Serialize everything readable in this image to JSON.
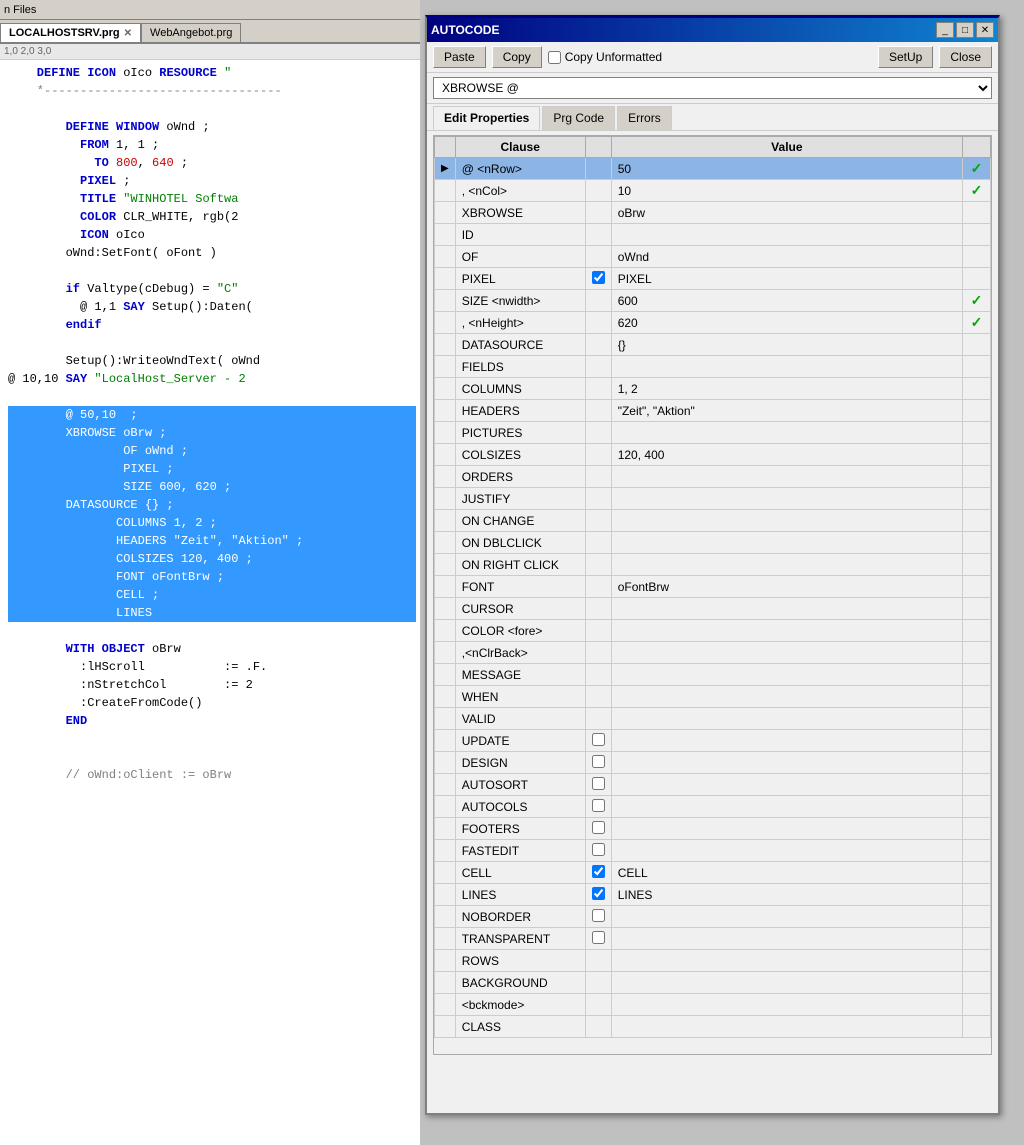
{
  "editor": {
    "toolbar_label": "n Files",
    "tabs": [
      {
        "label": "LOCALHOSTSRV.prg",
        "active": true
      },
      {
        "label": "WebAngebot.prg",
        "active": false
      }
    ],
    "ruler": "          1,0            2,0            3,0",
    "lines": [
      {
        "text": "    DEFINE ICON oIco RESOURCE \"",
        "type": "code",
        "highlight": false
      },
      {
        "text": "    *---------------------------------",
        "type": "comment",
        "highlight": false
      },
      {
        "text": "",
        "type": "blank",
        "highlight": false
      },
      {
        "text": "        DEFINE WINDOW oWnd ;",
        "type": "code",
        "highlight": false
      },
      {
        "text": "          FROM 1, 1 ;",
        "type": "code",
        "highlight": false
      },
      {
        "text": "            TO 800, 640 ;",
        "type": "code",
        "highlight": false
      },
      {
        "text": "          PIXEL ;",
        "type": "code",
        "highlight": false
      },
      {
        "text": "          TITLE \"WINHOTEL Softwa",
        "type": "code",
        "highlight": false
      },
      {
        "text": "          COLOR CLR_WHITE, rgb(2",
        "type": "code",
        "highlight": false
      },
      {
        "text": "          ICON oIco",
        "type": "code",
        "highlight": false
      },
      {
        "text": "        oWnd:SetFont( oFont )",
        "type": "code",
        "highlight": false
      },
      {
        "text": "",
        "type": "blank",
        "highlight": false
      },
      {
        "text": "        if Valtype(cDebug) = \"C\"",
        "type": "code",
        "highlight": false
      },
      {
        "text": "          @ 1,1 SAY Setup():Daten(",
        "type": "code",
        "highlight": false
      },
      {
        "text": "        endif",
        "type": "code",
        "highlight": false
      },
      {
        "text": "",
        "type": "blank",
        "highlight": false
      },
      {
        "text": "        Setup():WriteoWndText( oWnd",
        "type": "code",
        "highlight": false
      },
      {
        "text": "@ 10,10 SAY \"LocalHost_Server - 2",
        "type": "code",
        "highlight": false
      },
      {
        "text": "",
        "type": "blank",
        "highlight": false
      },
      {
        "text": "        @ 50,10  ;",
        "type": "highlight",
        "highlight": true
      },
      {
        "text": "        XBROWSE oBrw ;",
        "type": "highlight",
        "highlight": true
      },
      {
        "text": "                OF oWnd ;",
        "type": "highlight",
        "highlight": true
      },
      {
        "text": "                PIXEL ;",
        "type": "highlight",
        "highlight": true
      },
      {
        "text": "                SIZE 600, 620 ;",
        "type": "highlight",
        "highlight": true
      },
      {
        "text": "        DATASOURCE {} ;",
        "type": "highlight",
        "highlight": true
      },
      {
        "text": "               COLUMNS 1, 2 ;",
        "type": "highlight",
        "highlight": true
      },
      {
        "text": "               HEADERS \"Zeit\", \"Aktion\" ;",
        "type": "highlight",
        "highlight": true
      },
      {
        "text": "               COLSIZES 120, 400 ;",
        "type": "highlight",
        "highlight": true
      },
      {
        "text": "               FONT oFontBrw ;",
        "type": "highlight",
        "highlight": true
      },
      {
        "text": "               CELL ;",
        "type": "highlight",
        "highlight": true
      },
      {
        "text": "               LINES",
        "type": "highlight",
        "highlight": true
      },
      {
        "text": "",
        "type": "blank",
        "highlight": false
      },
      {
        "text": "        WITH OBJECT oBrw",
        "type": "code",
        "highlight": false
      },
      {
        "text": "          :lHScroll           := .F.",
        "type": "code",
        "highlight": false
      },
      {
        "text": "          :nStretchCol        := 2",
        "type": "code",
        "highlight": false
      },
      {
        "text": "          :CreateFromCode()",
        "type": "code",
        "highlight": false
      },
      {
        "text": "        END",
        "type": "code",
        "highlight": false
      },
      {
        "text": "",
        "type": "blank",
        "highlight": false
      },
      {
        "text": "",
        "type": "blank",
        "highlight": false
      },
      {
        "text": "        // oWnd:oClient := oBrw",
        "type": "comment",
        "highlight": false
      }
    ]
  },
  "autocode": {
    "title": "AUTOCODE",
    "buttons": {
      "paste": "Paste",
      "copy": "Copy",
      "copy_unformatted_label": "Copy Unformatted",
      "setup": "SetUp",
      "close": "Close"
    },
    "dropdown_value": "XBROWSE @",
    "tabs": [
      "Edit Properties",
      "Prg Code",
      "Errors"
    ],
    "active_tab": "Edit Properties",
    "table": {
      "headers": [
        "Clause",
        "",
        "Value"
      ],
      "rows": [
        {
          "arrow": true,
          "clause": "@ <nRow>",
          "checkbox": false,
          "has_checkbox": false,
          "value": "50",
          "check_right": true,
          "selected": true
        },
        {
          "arrow": false,
          "clause": ", <nCol>",
          "checkbox": false,
          "has_checkbox": false,
          "value": "10",
          "check_right": true,
          "selected": false
        },
        {
          "arrow": false,
          "clause": "XBROWSE",
          "checkbox": false,
          "has_checkbox": false,
          "value": "oBrw",
          "check_right": false,
          "selected": false
        },
        {
          "arrow": false,
          "clause": "ID",
          "checkbox": false,
          "has_checkbox": false,
          "value": "",
          "check_right": false,
          "selected": false
        },
        {
          "arrow": false,
          "clause": "OF",
          "checkbox": false,
          "has_checkbox": false,
          "value": "oWnd",
          "check_right": false,
          "selected": false
        },
        {
          "arrow": false,
          "clause": "PIXEL",
          "checkbox": true,
          "has_checkbox": true,
          "checkbox_checked": true,
          "value": "PIXEL",
          "check_right": false,
          "selected": false
        },
        {
          "arrow": false,
          "clause": "SIZE <nwidth>",
          "checkbox": false,
          "has_checkbox": false,
          "value": "600",
          "check_right": true,
          "selected": false
        },
        {
          "arrow": false,
          "clause": ", <nHeight>",
          "checkbox": false,
          "has_checkbox": false,
          "value": "620",
          "check_right": true,
          "selected": false
        },
        {
          "arrow": false,
          "clause": "DATASOURCE",
          "checkbox": false,
          "has_checkbox": false,
          "value": "{}",
          "check_right": false,
          "selected": false
        },
        {
          "arrow": false,
          "clause": "FIELDS",
          "checkbox": false,
          "has_checkbox": false,
          "value": "",
          "check_right": false,
          "selected": false
        },
        {
          "arrow": false,
          "clause": "COLUMNS",
          "checkbox": false,
          "has_checkbox": false,
          "value": "1, 2",
          "check_right": false,
          "selected": false
        },
        {
          "arrow": false,
          "clause": "HEADERS",
          "checkbox": false,
          "has_checkbox": false,
          "value": "\"Zeit\", \"Aktion\"",
          "check_right": false,
          "selected": false
        },
        {
          "arrow": false,
          "clause": "PICTURES",
          "checkbox": false,
          "has_checkbox": false,
          "value": "",
          "check_right": false,
          "selected": false
        },
        {
          "arrow": false,
          "clause": "COLSIZES",
          "checkbox": false,
          "has_checkbox": false,
          "value": "120, 400",
          "check_right": false,
          "selected": false
        },
        {
          "arrow": false,
          "clause": "ORDERS",
          "checkbox": false,
          "has_checkbox": false,
          "value": "",
          "check_right": false,
          "selected": false
        },
        {
          "arrow": false,
          "clause": "JUSTIFY",
          "checkbox": false,
          "has_checkbox": false,
          "value": "",
          "check_right": false,
          "selected": false
        },
        {
          "arrow": false,
          "clause": "ON CHANGE",
          "checkbox": false,
          "has_checkbox": false,
          "value": "",
          "check_right": false,
          "selected": false
        },
        {
          "arrow": false,
          "clause": "ON DBLCLICK",
          "checkbox": false,
          "has_checkbox": false,
          "value": "",
          "check_right": false,
          "selected": false
        },
        {
          "arrow": false,
          "clause": "ON RIGHT CLICK",
          "checkbox": false,
          "has_checkbox": false,
          "value": "",
          "check_right": false,
          "selected": false
        },
        {
          "arrow": false,
          "clause": "FONT",
          "checkbox": false,
          "has_checkbox": false,
          "value": "oFontBrw",
          "check_right": false,
          "selected": false
        },
        {
          "arrow": false,
          "clause": "CURSOR",
          "checkbox": false,
          "has_checkbox": false,
          "value": "",
          "check_right": false,
          "selected": false
        },
        {
          "arrow": false,
          "clause": "COLOR <fore>",
          "checkbox": false,
          "has_checkbox": false,
          "value": "",
          "check_right": false,
          "selected": false
        },
        {
          "arrow": false,
          "clause": ",<nClrBack>",
          "checkbox": false,
          "has_checkbox": false,
          "value": "",
          "check_right": false,
          "selected": false
        },
        {
          "arrow": false,
          "clause": "MESSAGE",
          "checkbox": false,
          "has_checkbox": false,
          "value": "",
          "check_right": false,
          "selected": false
        },
        {
          "arrow": false,
          "clause": "WHEN",
          "checkbox": false,
          "has_checkbox": false,
          "value": "",
          "check_right": false,
          "selected": false
        },
        {
          "arrow": false,
          "clause": "VALID",
          "checkbox": false,
          "has_checkbox": false,
          "value": "",
          "check_right": false,
          "selected": false
        },
        {
          "arrow": false,
          "clause": "UPDATE",
          "checkbox": false,
          "has_checkbox": true,
          "checkbox_checked": false,
          "value": "",
          "check_right": false,
          "selected": false
        },
        {
          "arrow": false,
          "clause": "DESIGN",
          "checkbox": false,
          "has_checkbox": true,
          "checkbox_checked": false,
          "value": "",
          "check_right": false,
          "selected": false
        },
        {
          "arrow": false,
          "clause": "AUTOSORT",
          "checkbox": false,
          "has_checkbox": true,
          "checkbox_checked": false,
          "value": "",
          "check_right": false,
          "selected": false
        },
        {
          "arrow": false,
          "clause": "AUTOCOLS",
          "checkbox": false,
          "has_checkbox": true,
          "checkbox_checked": false,
          "value": "",
          "check_right": false,
          "selected": false
        },
        {
          "arrow": false,
          "clause": "FOOTERS",
          "checkbox": false,
          "has_checkbox": true,
          "checkbox_checked": false,
          "value": "",
          "check_right": false,
          "selected": false
        },
        {
          "arrow": false,
          "clause": "FASTEDIT",
          "checkbox": false,
          "has_checkbox": true,
          "checkbox_checked": false,
          "value": "",
          "check_right": false,
          "selected": false
        },
        {
          "arrow": false,
          "clause": "CELL",
          "checkbox": false,
          "has_checkbox": true,
          "checkbox_checked": true,
          "value": "CELL",
          "check_right": false,
          "selected": false
        },
        {
          "arrow": false,
          "clause": "LINES",
          "checkbox": false,
          "has_checkbox": true,
          "checkbox_checked": true,
          "value": "LINES",
          "check_right": false,
          "selected": false
        },
        {
          "arrow": false,
          "clause": "NOBORDER",
          "checkbox": false,
          "has_checkbox": true,
          "checkbox_checked": false,
          "value": "",
          "check_right": false,
          "selected": false
        },
        {
          "arrow": false,
          "clause": "TRANSPARENT",
          "checkbox": false,
          "has_checkbox": true,
          "checkbox_checked": false,
          "value": "",
          "check_right": false,
          "selected": false
        },
        {
          "arrow": false,
          "clause": "ROWS",
          "checkbox": false,
          "has_checkbox": false,
          "value": "",
          "check_right": false,
          "selected": false
        },
        {
          "arrow": false,
          "clause": "BACKGROUND",
          "checkbox": false,
          "has_checkbox": false,
          "value": "",
          "check_right": false,
          "selected": false
        },
        {
          "arrow": false,
          "clause": "<bckmode>",
          "checkbox": false,
          "has_checkbox": false,
          "value": "",
          "check_right": false,
          "selected": false
        },
        {
          "arrow": false,
          "clause": "CLASS",
          "checkbox": false,
          "has_checkbox": false,
          "value": "",
          "check_right": false,
          "selected": false
        }
      ]
    }
  },
  "colors": {
    "keyword_blue": "#0000cc",
    "string_green": "#008000",
    "comment_gray": "#808080",
    "highlight_blue": "#3399ff",
    "number_red": "#cc0000",
    "check_green": "#00aa00"
  }
}
